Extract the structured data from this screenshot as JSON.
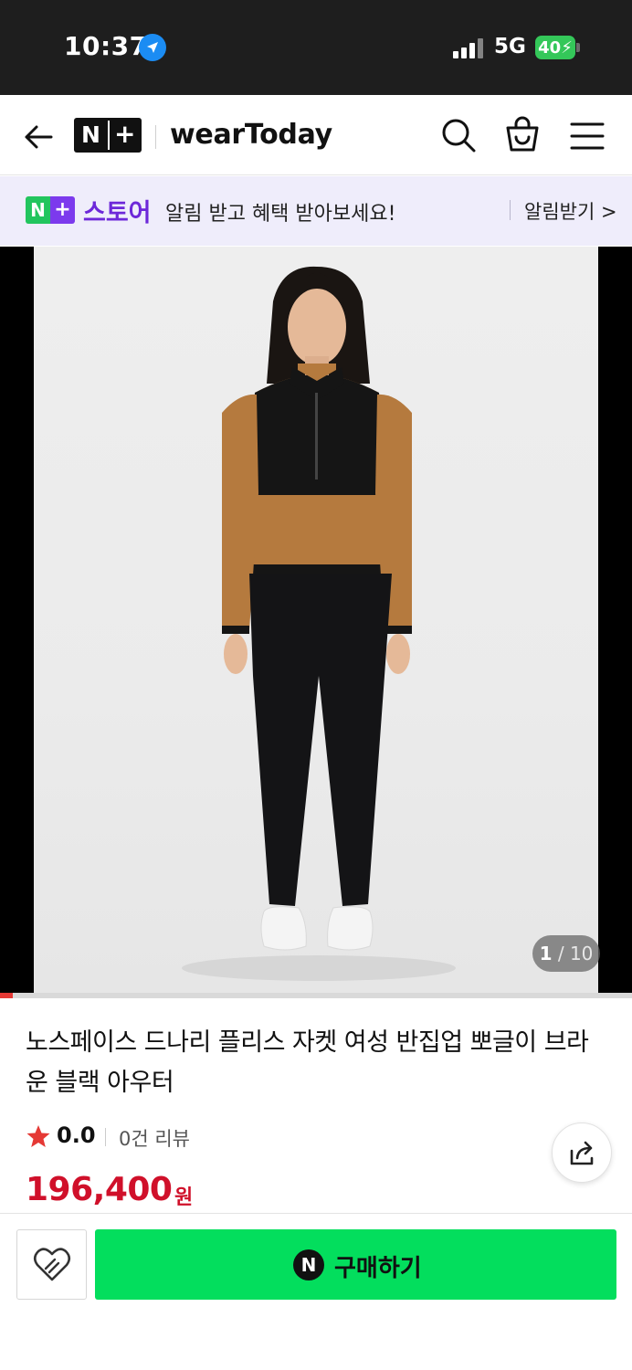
{
  "status_bar": {
    "time": "10:37",
    "network": "5G",
    "battery": "40"
  },
  "header": {
    "logo_n": "N",
    "logo_plus": "+",
    "brand": "wearToday"
  },
  "promo": {
    "logo_n": "N",
    "logo_plus": "+",
    "store": "스토어",
    "text": "알림 받고 혜택 받아보세요!",
    "link": "알림받기 >"
  },
  "gallery": {
    "current": "1",
    "total": "10",
    "progress_fraction": 0.02
  },
  "product": {
    "title": "노스페이스 드나리 플리스 자켓 여성 반집업 뽀글이 브라운 블랙 아우터",
    "rating": "0.0",
    "reviews": "0건 리뷰",
    "price": "196,400",
    "price_unit": "원"
  },
  "bottom": {
    "buy_icon": "N",
    "buy_label": "구매하기"
  },
  "colors": {
    "price_red": "#d0102a",
    "buy_green": "#03de5d",
    "store_purple": "#6d28d9",
    "promo_bg": "#efedfb",
    "star": "#e53935"
  },
  "icons": [
    "location-arrow-icon",
    "signal-icon",
    "battery-icon",
    "back-arrow-icon",
    "search-icon",
    "shopping-bag-icon",
    "hamburger-menu-icon",
    "star-icon",
    "share-icon",
    "wishlist-heart-icon"
  ]
}
